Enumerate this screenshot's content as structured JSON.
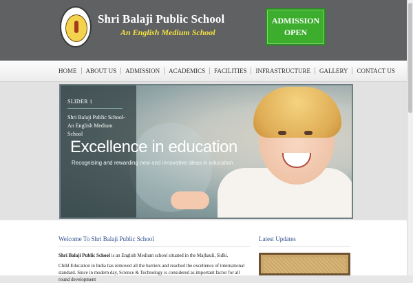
{
  "header": {
    "school_name": "Shri Balaji Public School",
    "tagline": "An English Medium School",
    "admission_line1": "ADMISSION",
    "admission_line2": "OPEN"
  },
  "nav": {
    "items": [
      {
        "label": "HOME"
      },
      {
        "label": "ABOUT US"
      },
      {
        "label": "ADMISSION"
      },
      {
        "label": "ACADEMICS"
      },
      {
        "label": "FACILITIES"
      },
      {
        "label": "INFRASTRUCTURE"
      },
      {
        "label": "GALLERY"
      },
      {
        "label": "CONTACT US"
      }
    ]
  },
  "slider": {
    "caption_title": "SLIDER 1",
    "caption_text": "Shri Balaji Public School- An English Medium School",
    "heading": "Excellence in education",
    "subheading": "Recognising and rewarding new and innovative ideas in education"
  },
  "welcome": {
    "title": "Welcome To Shri Balaji Public School",
    "p1_bold": "Shri Balaji Public School",
    "p1_rest": " is an English Medium school situated in the Majhauli, Sidhi.",
    "p2": "Child Education in India has removed all the barriers and reached the excellence of international standard. Since in modern day, Science & Technology is considered as important factor for all round development"
  },
  "updates": {
    "title": "Latest Updates"
  },
  "colors": {
    "header_bg": "#5f6163",
    "accent_yellow": "#f5e13f",
    "admission_green": "#3cad2d",
    "link_blue": "#2c4d8b"
  }
}
